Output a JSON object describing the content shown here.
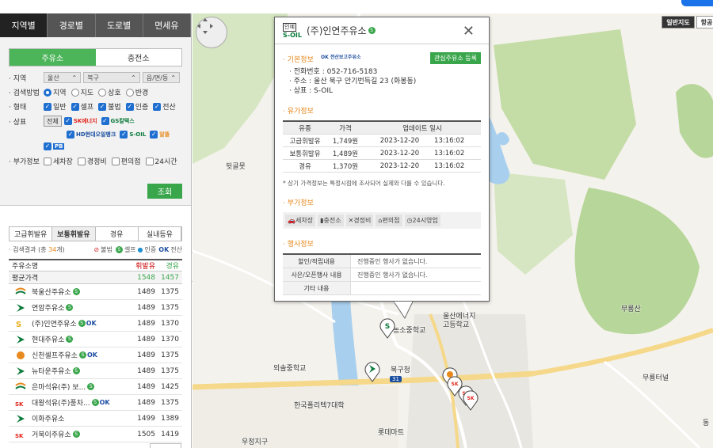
{
  "main_tabs": [
    "지역별",
    "경로별",
    "도로별",
    "면세유"
  ],
  "search": {
    "subtabs": [
      "주유소",
      "충전소"
    ],
    "region_label": "지역",
    "region": {
      "sido": "울산",
      "gu": "북구",
      "dong": "읍/면/동"
    },
    "method_label": "검색방법",
    "methods": [
      "지역",
      "지도",
      "상호",
      "반경"
    ],
    "form_label": "형태",
    "forms": [
      "일반",
      "셀프",
      "불법",
      "인증",
      "전산"
    ],
    "brand_label": "상표",
    "brand_all": "전체",
    "brands": [
      "SK에너지",
      "GS칼텍스",
      "HD현대오일뱅크",
      "S-OIL",
      "알뜰",
      "PB"
    ],
    "extra_label": "부가정보",
    "extras": [
      "세차장",
      "경정비",
      "편의점",
      "24시간"
    ],
    "search_button": "조회"
  },
  "product_tabs": [
    "고급휘발유",
    "보통휘발유",
    "경유",
    "실내등유"
  ],
  "results": {
    "prefix": "· 검색결과 (총 ",
    "count": "34",
    "suffix": "개)",
    "legend": [
      "불법",
      "셀프",
      "인증",
      "전산"
    ],
    "col_name": "주유소명",
    "col_gas": "휘발유",
    "col_diesel": "경유",
    "avg": {
      "name": "평균가격",
      "gas": "1548",
      "diesel": "1457"
    },
    "rows": [
      {
        "name": "북울산주유소",
        "brand": "GS",
        "self": true,
        "ok": false,
        "gas": "1489",
        "diesel": "1375"
      },
      {
        "name": "연암주유소",
        "brand": "HD",
        "self": true,
        "ok": false,
        "gas": "1489",
        "diesel": "1375"
      },
      {
        "name": "(주)인연주유소",
        "brand": "SOIL",
        "self": true,
        "ok": true,
        "gas": "1489",
        "diesel": "1370"
      },
      {
        "name": "현대주유소",
        "brand": "HD",
        "self": true,
        "ok": false,
        "gas": "1489",
        "diesel": "1370"
      },
      {
        "name": "신천셀프주유소",
        "brand": "ALDDEUL",
        "self": true,
        "ok": true,
        "gas": "1489",
        "diesel": "1375"
      },
      {
        "name": "뉴타운주유소",
        "brand": "HD",
        "self": true,
        "ok": false,
        "gas": "1489",
        "diesel": "1375"
      },
      {
        "name": "은마석유(주) 보...",
        "brand": "GS",
        "self": true,
        "ok": false,
        "gas": "1489",
        "diesel": "1425"
      },
      {
        "name": "대왕석유(주)풍차...",
        "brand": "SK",
        "self": true,
        "ok": true,
        "gas": "1489",
        "diesel": "1375"
      },
      {
        "name": "이화주유소",
        "brand": "HD",
        "self": false,
        "ok": false,
        "gas": "1499",
        "diesel": "1389"
      },
      {
        "name": "거북이주유소",
        "brand": "SK",
        "self": true,
        "ok": false,
        "gas": "1505",
        "diesel": "1419"
      }
    ]
  },
  "map": {
    "type_buttons": [
      "일반지도",
      "항공"
    ],
    "labels": {
      "l1": "뒷골못",
      "l2": "무룡산",
      "l3": "울산에너지",
      "l4": "고등학교",
      "l5": "농소중학교",
      "l6": "외솔중학교",
      "l7": "북구청",
      "l8": "한국폴리텍7대학",
      "l9": "롯데마트",
      "l10": "무룡터널",
      "l11": "우정지구",
      "l12": "31",
      "l13": "동"
    }
  },
  "popup": {
    "tag": "인예",
    "brand": "S-OIL",
    "title": "(주)인연주유소",
    "sect_basic": "· 기본정보",
    "ok_text": "전산보고주유소",
    "fav_button": "관심주유소 등록",
    "phone": "· 전화번호 : 052-716-5183",
    "address": "· 주소 : 울산 북구 안기번득길 23 (화봉동)",
    "brand_line": "· 상표 : S-OIL",
    "sect_price": "· 유가정보",
    "price_head": {
      "a": "유종",
      "b": "가격",
      "c": "업데이트 일시"
    },
    "prices": [
      {
        "a": "고급휘발유",
        "b": "1,749원",
        "c": "2023-12-20       13:16:02"
      },
      {
        "a": "보통휘발유",
        "b": "1,489원",
        "c": "2023-12-20       13:16:02"
      },
      {
        "a": "경유",
        "b": "1,370원",
        "c": "2023-12-20       13:16:02"
      }
    ],
    "note": "* 상기 가격정보는 특정시점에 조사되어 실제와 다를 수 있습니다.",
    "sect_extra": "· 부가정보",
    "amenities": [
      "세차장",
      "충전소",
      "경정비",
      "편의점",
      "24시영업"
    ],
    "sect_event": "· 행사정보",
    "events": [
      {
        "k": "할인/적립내용",
        "v": "진행중인 행사가 없습니다."
      },
      {
        "k": "사은/오픈행사 내용",
        "v": "진행중인 행사가 없습니다."
      },
      {
        "k": "기타 내용",
        "v": ""
      }
    ]
  }
}
